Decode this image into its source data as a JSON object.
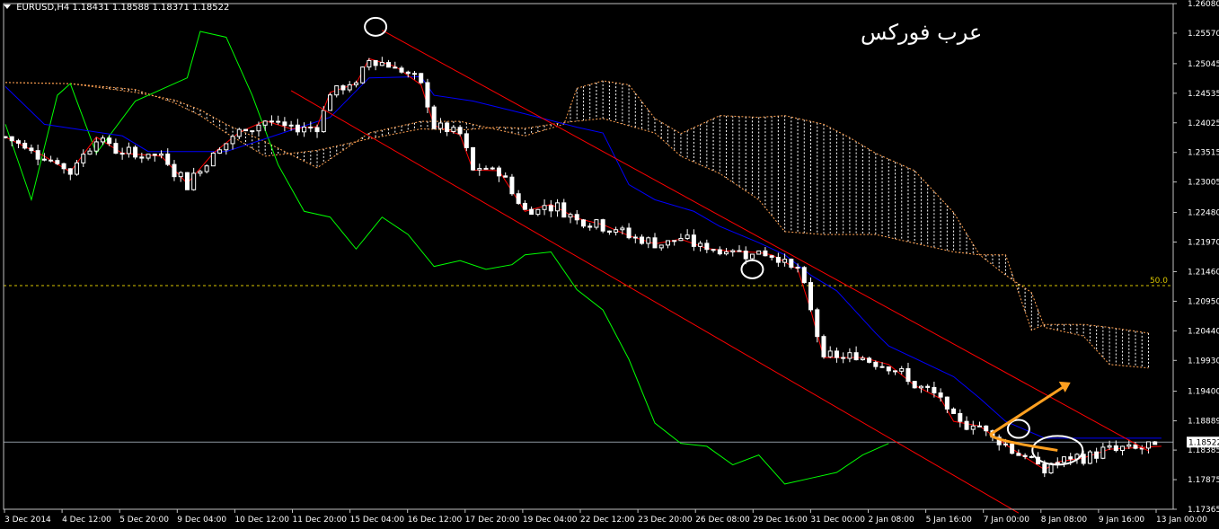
{
  "header": {
    "symbol": "EURUSD,H4",
    "ohlc": "1.18431 1.18588 1.18371 1.18522"
  },
  "brand_text": "عرب فوركس",
  "chart_data": {
    "type": "candlestick",
    "symbol": "EURUSD",
    "timeframe": "H4",
    "ylim": [
      1.17365,
      1.2608
    ],
    "y_ticks": [
      "1.26080",
      "1.25570",
      "1.25045",
      "1.24535",
      "1.24025",
      "1.23515",
      "1.23005",
      "1.22480",
      "1.21970",
      "1.21460",
      "1.20950",
      "1.20440",
      "1.19930",
      "1.19400",
      "1.18889",
      "1.18385",
      "1.17875",
      "1.17365"
    ],
    "x_ticks": [
      "3 Dec 2014",
      "4 Dec 12:00",
      "5 Dec 20:00",
      "9 Dec 04:00",
      "10 Dec 12:00",
      "11 Dec 20:00",
      "15 Dec 04:00",
      "16 Dec 12:00",
      "17 Dec 20:00",
      "19 Dec 04:00",
      "22 Dec 12:00",
      "23 Dec 20:00",
      "26 Dec 08:00",
      "29 Dec 16:00",
      "31 Dec 00:00",
      "2 Jan 08:00",
      "5 Jan 16:00",
      "7 Jan 00:00",
      "8 Jan 08:00",
      "9 Jan 16:00",
      "13 Jan 00:00"
    ],
    "current_price": "1.18522",
    "fib_level": {
      "label": "50.0",
      "price": 1.2122
    },
    "colors": {
      "background": "#000000",
      "candle": "#ffffff",
      "tenkan": "#ff0000",
      "kijun": "#0000ff",
      "chikou": "#00ff00",
      "cloud": "#ffffff",
      "cloud_edge": "#ffa050",
      "channel": "#ff0000",
      "fib": "#d7c300",
      "arrow": "#ffa020",
      "annotation": "#ffffff"
    },
    "series": [
      {
        "name": "price",
        "style": "candlestick"
      },
      {
        "name": "tenkan",
        "style": "line",
        "values": [
          [
            0,
            1.2378
          ],
          [
            6,
            1.2345
          ],
          [
            10,
            1.2318
          ],
          [
            14,
            1.2378
          ],
          [
            18,
            1.235
          ],
          [
            24,
            1.2345
          ],
          [
            28,
            1.2298
          ],
          [
            32,
            1.235
          ],
          [
            36,
            1.2386
          ],
          [
            40,
            1.2406
          ],
          [
            44,
            1.2392
          ],
          [
            48,
            1.2396
          ],
          [
            50,
            1.2455
          ],
          [
            54,
            1.247
          ],
          [
            56,
            1.2513
          ],
          [
            60,
            1.25
          ],
          [
            64,
            1.2468
          ],
          [
            66,
            1.2398
          ],
          [
            70,
            1.2382
          ],
          [
            72,
            1.2321
          ],
          [
            76,
            1.232
          ],
          [
            80,
            1.225
          ],
          [
            84,
            1.2262
          ],
          [
            88,
            1.2238
          ],
          [
            92,
            1.2227
          ],
          [
            96,
            1.2208
          ],
          [
            100,
            1.2194
          ],
          [
            104,
            1.2202
          ],
          [
            108,
            1.2186
          ],
          [
            112,
            1.2181
          ],
          [
            116,
            1.2179
          ],
          [
            118,
            1.2175
          ],
          [
            122,
            1.215
          ],
          [
            124,
            1.208
          ],
          [
            126,
            1.1998
          ],
          [
            132,
            1.1998
          ],
          [
            136,
            1.1986
          ],
          [
            140,
            1.195
          ],
          [
            144,
            1.1927
          ],
          [
            146,
            1.1888
          ],
          [
            150,
            1.188
          ],
          [
            154,
            1.1848
          ],
          [
            158,
            1.1819
          ],
          [
            160,
            1.1805
          ],
          [
            162,
            1.1818
          ],
          [
            166,
            1.1825
          ],
          [
            170,
            1.184
          ],
          [
            178,
            1.1845
          ]
        ]
      },
      {
        "name": "kijun",
        "style": "line",
        "values": [
          [
            0,
            1.2465
          ],
          [
            6,
            1.24
          ],
          [
            18,
            1.238
          ],
          [
            22,
            1.2353
          ],
          [
            34,
            1.2353
          ],
          [
            40,
            1.2375
          ],
          [
            50,
            1.2412
          ],
          [
            56,
            1.248
          ],
          [
            64,
            1.2482
          ],
          [
            66,
            1.245
          ],
          [
            72,
            1.244
          ],
          [
            80,
            1.2418
          ],
          [
            88,
            1.2395
          ],
          [
            92,
            1.2385
          ],
          [
            96,
            1.2296
          ],
          [
            100,
            1.227
          ],
          [
            106,
            1.225
          ],
          [
            110,
            1.2224
          ],
          [
            116,
            1.2196
          ],
          [
            120,
            1.2175
          ],
          [
            124,
            1.214
          ],
          [
            128,
            1.2113
          ],
          [
            134,
            1.204
          ],
          [
            136,
            1.2018
          ],
          [
            146,
            1.1965
          ],
          [
            150,
            1.1928
          ],
          [
            154,
            1.1888
          ],
          [
            160,
            1.1859
          ],
          [
            170,
            1.1859
          ],
          [
            178,
            1.1859
          ]
        ]
      },
      {
        "name": "chikou",
        "style": "line",
        "values": [
          [
            0,
            1.24
          ],
          [
            4,
            1.227
          ],
          [
            8,
            1.245
          ],
          [
            10,
            1.247
          ],
          [
            14,
            1.235
          ],
          [
            20,
            1.244
          ],
          [
            28,
            1.248
          ],
          [
            30,
            1.256
          ],
          [
            34,
            1.255
          ],
          [
            38,
            1.245
          ],
          [
            42,
            1.233
          ],
          [
            46,
            1.225
          ],
          [
            50,
            1.224
          ],
          [
            54,
            1.2185
          ],
          [
            58,
            1.224
          ],
          [
            62,
            1.221
          ],
          [
            66,
            1.2155
          ],
          [
            70,
            1.2165
          ],
          [
            74,
            1.215
          ],
          [
            78,
            1.2158
          ],
          [
            80,
            1.2175
          ],
          [
            84,
            1.218
          ],
          [
            88,
            1.2115
          ],
          [
            92,
            1.208
          ],
          [
            96,
            1.1995
          ],
          [
            100,
            1.1885
          ],
          [
            104,
            1.185
          ],
          [
            108,
            1.1845
          ],
          [
            112,
            1.1813
          ],
          [
            116,
            1.183
          ],
          [
            120,
            1.178
          ],
          [
            124,
            1.179
          ],
          [
            128,
            1.18
          ],
          [
            132,
            1.183
          ],
          [
            136,
            1.185
          ]
        ]
      },
      {
        "name": "cloud_span_a",
        "style": "line",
        "values": [
          [
            0,
            1.2472
          ],
          [
            10,
            1.247
          ],
          [
            20,
            1.2455
          ],
          [
            26,
            1.2442
          ],
          [
            30,
            1.2425
          ],
          [
            34,
            1.24
          ],
          [
            40,
            1.237
          ],
          [
            48,
            1.2325
          ],
          [
            56,
            1.2385
          ],
          [
            64,
            1.2405
          ],
          [
            70,
            1.2405
          ],
          [
            80,
            1.238
          ],
          [
            86,
            1.24
          ],
          [
            88,
            1.2462
          ],
          [
            92,
            1.2475
          ],
          [
            96,
            1.2468
          ],
          [
            100,
            1.241
          ],
          [
            104,
            1.2384
          ],
          [
            110,
            1.2415
          ],
          [
            116,
            1.2412
          ],
          [
            120,
            1.2415
          ],
          [
            126,
            1.24
          ],
          [
            130,
            1.2377
          ],
          [
            134,
            1.235
          ],
          [
            140,
            1.232
          ],
          [
            146,
            1.2248
          ],
          [
            150,
            1.2175
          ],
          [
            154,
            1.214
          ],
          [
            158,
            1.211
          ],
          [
            160,
            1.205
          ],
          [
            166,
            1.2035
          ],
          [
            170,
            1.1986
          ],
          [
            176,
            1.198
          ]
        ]
      },
      {
        "name": "cloud_span_b",
        "style": "line",
        "values": [
          [
            0,
            1.2472
          ],
          [
            10,
            1.247
          ],
          [
            20,
            1.246
          ],
          [
            26,
            1.2437
          ],
          [
            30,
            1.2415
          ],
          [
            34,
            1.2385
          ],
          [
            40,
            1.2345
          ],
          [
            48,
            1.2355
          ],
          [
            56,
            1.2375
          ],
          [
            64,
            1.2392
          ],
          [
            70,
            1.239
          ],
          [
            76,
            1.2395
          ],
          [
            80,
            1.2393
          ],
          [
            86,
            1.2403
          ],
          [
            92,
            1.241
          ],
          [
            100,
            1.2385
          ],
          [
            104,
            1.2345
          ],
          [
            110,
            1.2315
          ],
          [
            116,
            1.227
          ],
          [
            120,
            1.2215
          ],
          [
            126,
            1.221
          ],
          [
            134,
            1.221
          ],
          [
            140,
            1.2195
          ],
          [
            146,
            1.218
          ],
          [
            150,
            1.2175
          ],
          [
            154,
            1.2175
          ],
          [
            158,
            1.2045
          ],
          [
            160,
            1.2055
          ],
          [
            166,
            1.2055
          ],
          [
            170,
            1.205
          ],
          [
            176,
            1.204
          ]
        ]
      },
      {
        "name": "channel_upper",
        "style": "line",
        "values": [
          [
            58,
            1.2562
          ],
          [
            176,
            1.1837
          ]
        ]
      },
      {
        "name": "channel_lower",
        "style": "line",
        "values": [
          [
            44,
            1.2458
          ],
          [
            156,
            1.173
          ]
        ]
      }
    ],
    "annotations": [
      {
        "type": "ellipse",
        "at": [
          57,
          1.2568
        ]
      },
      {
        "type": "ellipse",
        "at": [
          115,
          1.215
        ]
      },
      {
        "type": "ellipse",
        "at": [
          156,
          1.1875
        ]
      },
      {
        "type": "ellipse",
        "at": [
          162,
          1.1838
        ]
      },
      {
        "type": "arrow",
        "from": [
          152,
          1.1868
        ],
        "to": [
          164,
          1.1955
        ]
      }
    ]
  }
}
